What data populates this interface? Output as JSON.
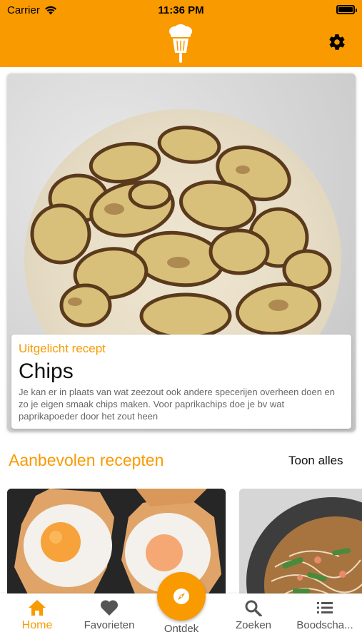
{
  "status": {
    "carrier": "Carrier",
    "time": "11:36 PM"
  },
  "colors": {
    "accent": "#f99a00",
    "text": "#111111",
    "muted": "#666666"
  },
  "header": {
    "logo_icon": "chef-hat-whisk-icon",
    "settings_icon": "gear-icon"
  },
  "featured": {
    "label": "Uitgelicht recept",
    "title": "Chips",
    "description": "Je kan er in plaats van wat zeezout ook andere specerijen overheen doen en zo je eigen smaak chips maken. Voor paprikachips doe je bv wat paprikapoeder door het zout heen"
  },
  "recommended": {
    "title": "Aanbevolen recepten",
    "show_all": "Toon alles"
  },
  "tabs": [
    {
      "label": "Home",
      "icon": "home-icon",
      "active": true
    },
    {
      "label": "Favorieten",
      "icon": "heart-icon",
      "active": false
    },
    {
      "label": "Ontdek",
      "icon": "compass-icon",
      "active": false
    },
    {
      "label": "Zoeken",
      "icon": "search-icon",
      "active": false
    },
    {
      "label": "Boodscha...",
      "icon": "list-icon",
      "active": false
    }
  ]
}
